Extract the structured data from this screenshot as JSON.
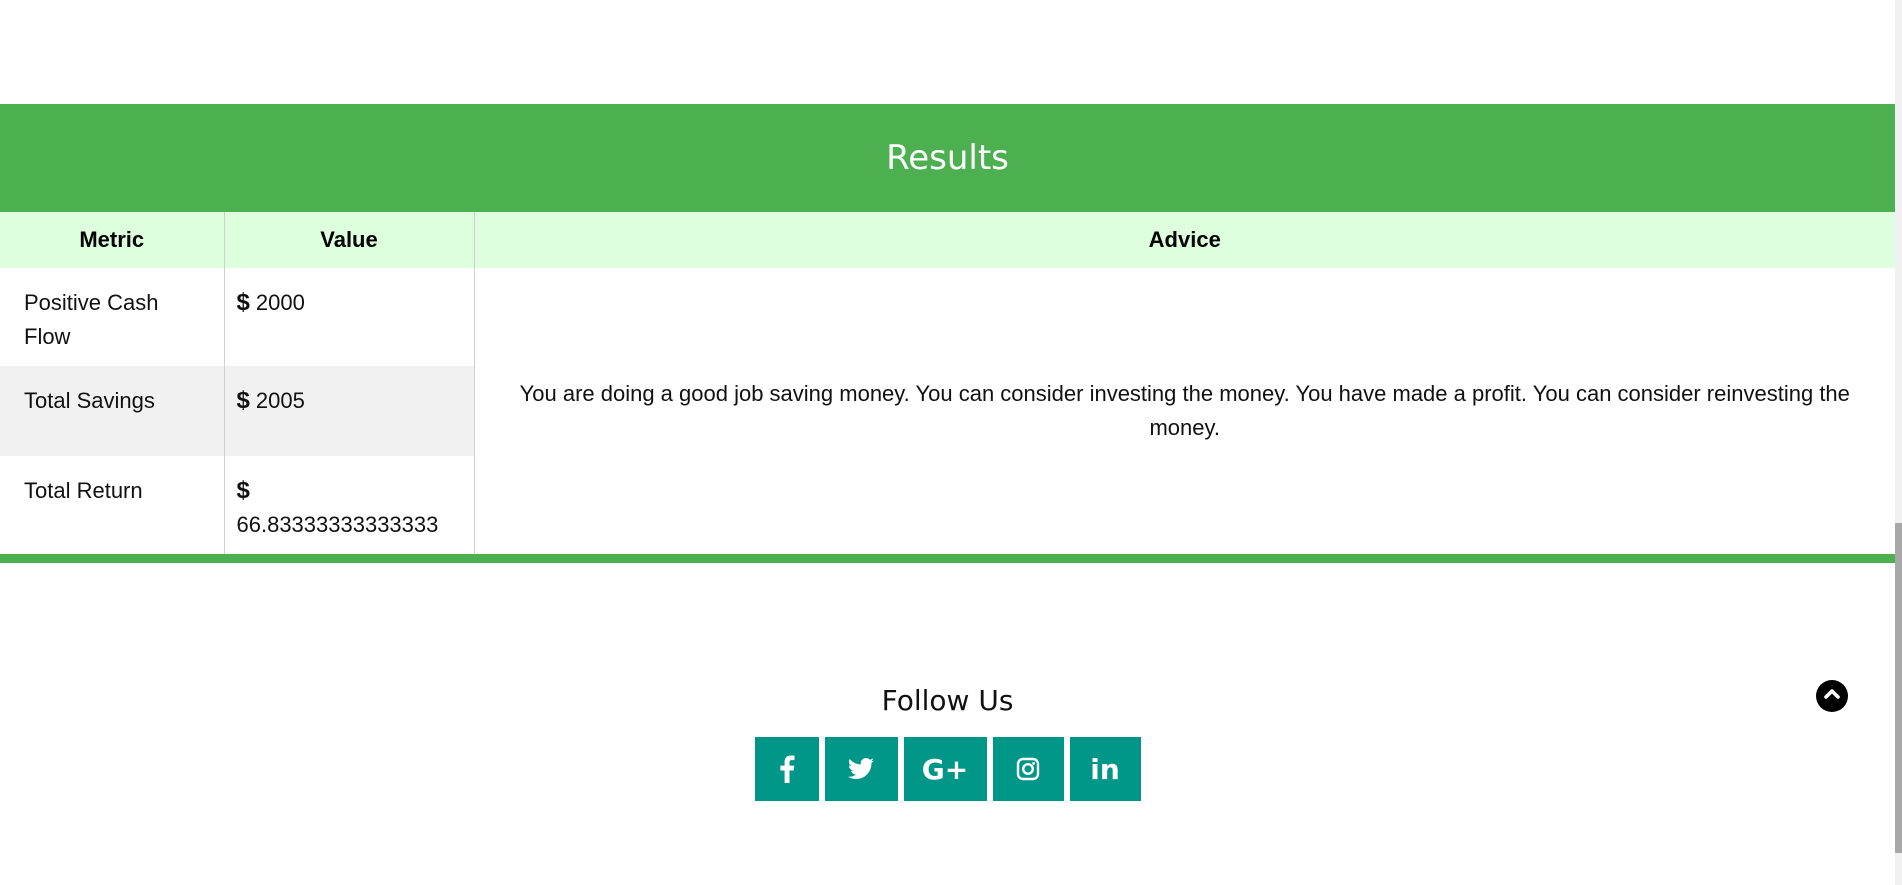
{
  "results": {
    "title": "Results",
    "columns": {
      "metric": "Metric",
      "value": "Value",
      "advice": "Advice"
    },
    "currency_symbol": "$",
    "rows": [
      {
        "metric": "Positive Cash Flow",
        "value": "2000"
      },
      {
        "metric": "Total Savings",
        "value": "2005"
      },
      {
        "metric": "Total Return",
        "value": "66.83333333333333"
      }
    ],
    "advice": "You are doing a good job saving money. You can consider investing the money. You have made a profit. You can consider reinvesting the money."
  },
  "follow": {
    "title": "Follow Us",
    "social": [
      {
        "label": "f",
        "icon": "facebook-icon"
      },
      {
        "label": "twitter",
        "icon": "twitter-icon"
      },
      {
        "label": "G+",
        "icon": "google-plus-icon"
      },
      {
        "label": "instagram",
        "icon": "instagram-icon"
      },
      {
        "label": "in",
        "icon": "linkedin-icon"
      }
    ]
  },
  "scroll_top": {
    "icon": "chevron-up-icon"
  },
  "colors": {
    "accent_green": "#4caf50",
    "header_row_bg": "#ddffdd",
    "social_teal": "#009688"
  }
}
